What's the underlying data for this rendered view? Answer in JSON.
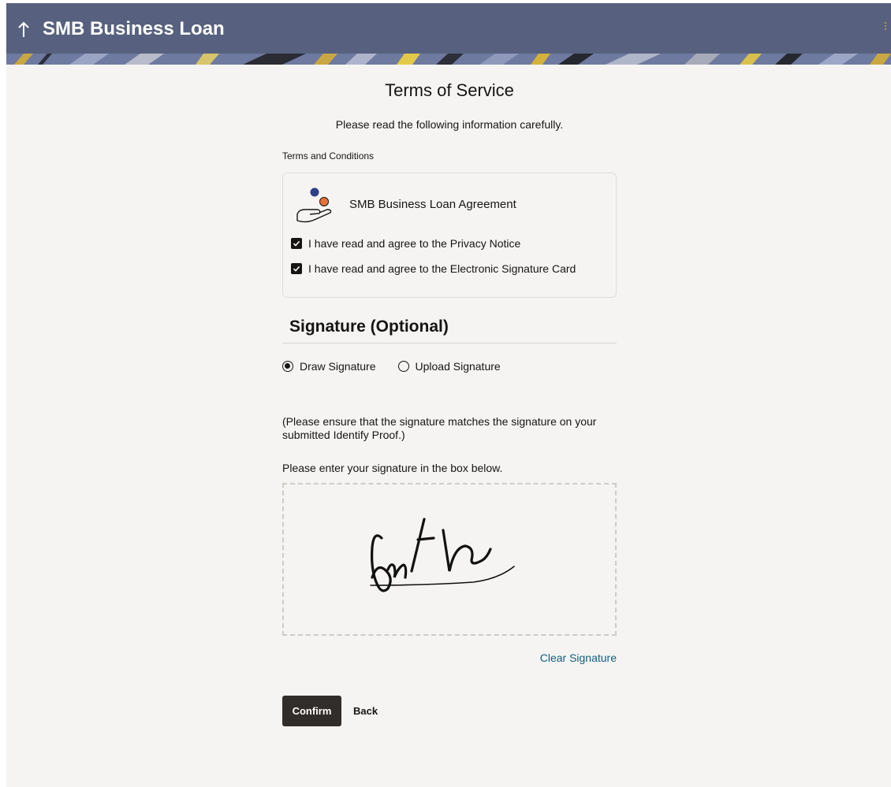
{
  "header": {
    "title": "SMB Business Loan",
    "back_icon": "arrow-up-icon",
    "menu_icon": "kebab-icon",
    "bar_color": "#57617f"
  },
  "terms": {
    "title": "Terms of Service",
    "subtitle": "Please read the following information carefully.",
    "section_label": "Terms and Conditions",
    "agreement_icon": "hand-coins-icon",
    "agreement_title": "SMB Business Loan Agreement",
    "checkboxes": [
      {
        "label": "I have read and agree to the Privacy Notice",
        "checked": true
      },
      {
        "label": "I have read and agree to the Electronic Signature Card",
        "checked": true
      }
    ]
  },
  "signature": {
    "heading": "Signature (Optional)",
    "options": [
      {
        "label": "Draw Signature",
        "selected": true
      },
      {
        "label": "Upload Signature",
        "selected": false
      }
    ],
    "ensure_note": "(Please ensure that the signature matches the signature on your submitted Identify Proof.)",
    "enter_note": "Please enter your signature in the box below.",
    "clear_label": "Clear Signature"
  },
  "actions": {
    "confirm_label": "Confirm",
    "back_label": "Back"
  },
  "colors": {
    "primary_button": "#312d2a",
    "link": "#116080",
    "background": "#f5f4f2"
  }
}
